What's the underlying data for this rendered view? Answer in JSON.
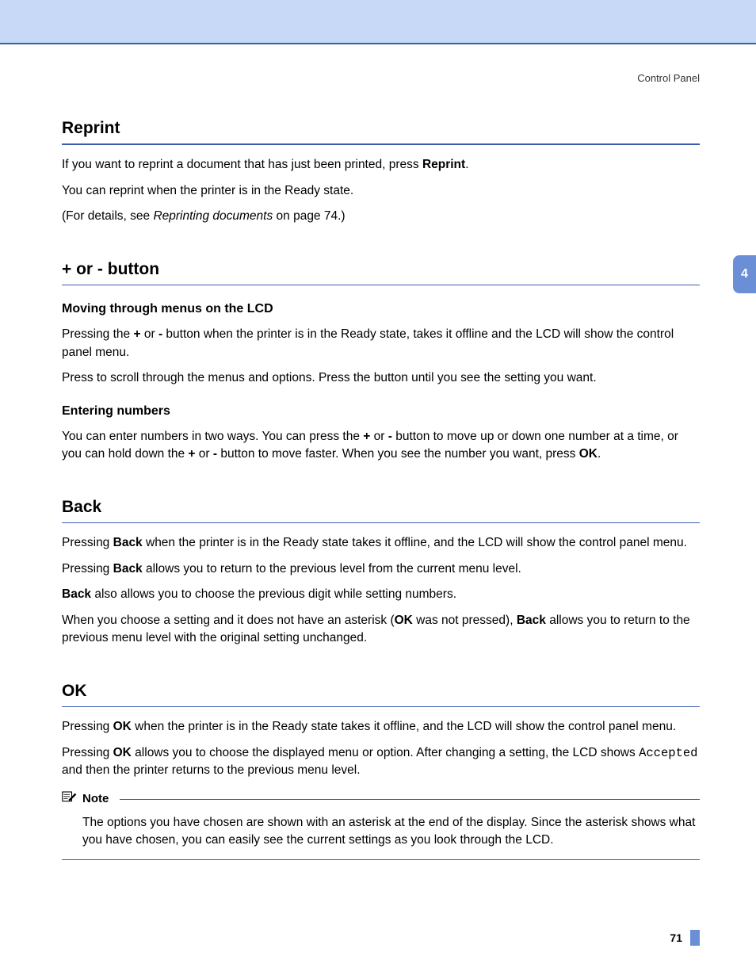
{
  "header": {
    "section_label": "Control Panel"
  },
  "side_tab": {
    "chapter": "4"
  },
  "reprint": {
    "title": "Reprint",
    "p1_a": "If you want to reprint a document that has just been printed, press ",
    "p1_b": "Reprint",
    "p1_c": ".",
    "p2": "You can reprint when the printer is in the Ready state.",
    "p3_a": "(For details, see ",
    "p3_b": "Reprinting documents",
    "p3_c": " on page 74.)"
  },
  "plusminus": {
    "title": "+ or - button",
    "sub1": "Moving through menus on the LCD",
    "s1p1_a": "Pressing the ",
    "s1p1_b": "+",
    "s1p1_c": " or ",
    "s1p1_d": "-",
    "s1p1_e": " button when the printer is in the Ready state, takes it offline and the LCD will show the control panel menu.",
    "s1p2": "Press to scroll through the menus and options. Press the button until you see the setting you want.",
    "sub2": "Entering numbers",
    "s2p1_a": "You can enter numbers in two ways. You can press the ",
    "s2p1_b": "+",
    "s2p1_c": " or ",
    "s2p1_d": "-",
    "s2p1_e": " button to move up or down one number at a time, or you can hold down the ",
    "s2p1_f": "+",
    "s2p1_g": " or ",
    "s2p1_h": "-",
    "s2p1_i": " button to move faster. When you see the number you want, press ",
    "s2p1_j": "OK",
    "s2p1_k": "."
  },
  "back": {
    "title": "Back",
    "p1_a": "Pressing ",
    "p1_b": "Back",
    "p1_c": " when the printer is in the Ready state takes it offline, and the LCD will show the control panel menu.",
    "p2_a": "Pressing ",
    "p2_b": "Back",
    "p2_c": " allows you to return to the previous level from the current menu level.",
    "p3_a": "Back",
    "p3_b": " also allows you to choose the previous digit while setting numbers.",
    "p4_a": "When you choose a setting and it does not have an asterisk (",
    "p4_b": "OK",
    "p4_c": " was not pressed), ",
    "p4_d": "Back",
    "p4_e": " allows you to return to the previous menu level with the original setting unchanged."
  },
  "ok": {
    "title": "OK",
    "p1_a": "Pressing ",
    "p1_b": "OK",
    "p1_c": " when the printer is in the Ready state takes it offline, and the LCD will show the control panel menu.",
    "p2_a": "Pressing ",
    "p2_b": "OK",
    "p2_c": " allows you to choose the displayed menu or option. After changing a setting, the LCD shows ",
    "p2_d": "Accepted",
    "p2_e": " and then the printer returns to the previous menu level."
  },
  "note": {
    "label": "Note",
    "body": "The options you have chosen are shown with an asterisk at the end of the display. Since the asterisk shows what you have chosen, you can easily see the current settings as you look through the LCD."
  },
  "footer": {
    "page": "71"
  }
}
